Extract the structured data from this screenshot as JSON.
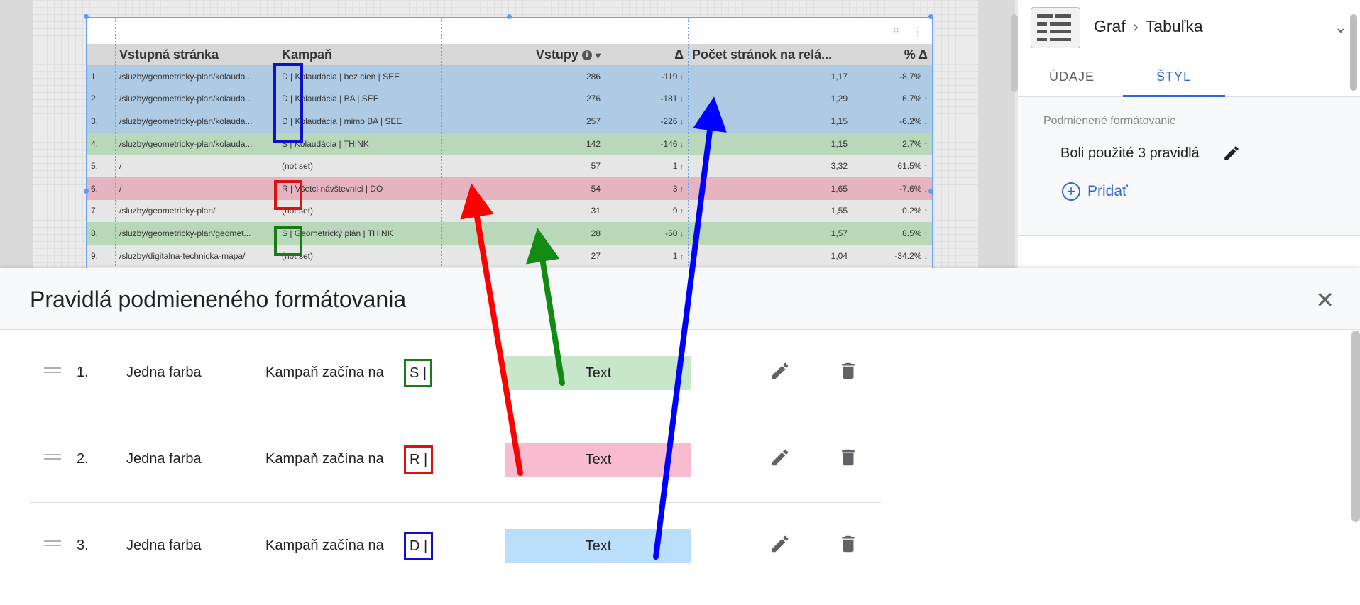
{
  "report": {
    "columns": [
      "",
      "Vstupná stránka",
      "Kampaň",
      "Vstupy",
      "Δ",
      "Počet stránok na relá...",
      "% Δ"
    ],
    "sort_indicator": "▾",
    "info_icon": "i",
    "rows": [
      {
        "idx": "1.",
        "page": "/sluzby/geometricky-plan/kolauda...",
        "campaign": "D | Kolaudácia | bez cien | SEE",
        "entries": "286",
        "delta": "-119",
        "delta_dir": "down",
        "pages": "1,17",
        "pct": "-8.7%",
        "pct_dir": "down",
        "color": "#aecbe3"
      },
      {
        "idx": "2.",
        "page": "/sluzby/geometricky-plan/kolauda...",
        "campaign": "D | Kolaudácia | BA | SEE",
        "entries": "276",
        "delta": "-181",
        "delta_dir": "down",
        "pages": "1,29",
        "pct": "6.7%",
        "pct_dir": "up",
        "color": "#aecbe3"
      },
      {
        "idx": "3.",
        "page": "/sluzby/geometricky-plan/kolauda...",
        "campaign": "D | Kolaudácia | mimo BA | SEE",
        "entries": "257",
        "delta": "-226",
        "delta_dir": "down",
        "pages": "1,15",
        "pct": "-6.2%",
        "pct_dir": "down",
        "color": "#aecbe3"
      },
      {
        "idx": "4.",
        "page": "/sluzby/geometricky-plan/kolauda...",
        "campaign": "S | Kolaudácia | THINK",
        "entries": "142",
        "delta": "-146",
        "delta_dir": "down",
        "pages": "1,15",
        "pct": "2.7%",
        "pct_dir": "up",
        "color": "#b9d8b9"
      },
      {
        "idx": "5.",
        "page": "/",
        "campaign": "(not set)",
        "entries": "57",
        "delta": "1",
        "delta_dir": "up",
        "pages": "3,32",
        "pct": "61.5%",
        "pct_dir": "up",
        "color": "#e6e6e6"
      },
      {
        "idx": "6.",
        "page": "/",
        "campaign": "R | Všetci návštevníci | DO",
        "entries": "54",
        "delta": "3",
        "delta_dir": "up",
        "pages": "1,65",
        "pct": "-7.6%",
        "pct_dir": "down",
        "color": "#e6b4c1"
      },
      {
        "idx": "7.",
        "page": "/sluzby/geometricky-plan/",
        "campaign": "(not set)",
        "entries": "31",
        "delta": "9",
        "delta_dir": "up",
        "pages": "1,55",
        "pct": "0.2%",
        "pct_dir": "up",
        "color": "#e6e6e6"
      },
      {
        "idx": "8.",
        "page": "/sluzby/geometricky-plan/geomet...",
        "campaign": "S | Geometrický plán | THINK",
        "entries": "28",
        "delta": "-50",
        "delta_dir": "down",
        "pages": "1,57",
        "pct": "8.5%",
        "pct_dir": "up",
        "color": "#b9d8b9"
      },
      {
        "idx": "9.",
        "page": "/sluzby/digitalna-technicka-mapa/",
        "campaign": "(not set)",
        "entries": "27",
        "delta": "1",
        "delta_dir": "up",
        "pages": "1,04",
        "pct": "-34.2%",
        "pct_dir": "down",
        "color": "#e6e6e6"
      }
    ]
  },
  "side": {
    "breadcrumb_1": "Graf",
    "breadcrumb_sep": "›",
    "breadcrumb_2": "Tabuľka",
    "tab_data": "ÚDAJE",
    "tab_style": "ŠTÝL",
    "cf_label": "Podmienené formátovanie",
    "cf_applied": "Boli použité 3 pravidlá",
    "cf_add": "Pridať"
  },
  "dialog": {
    "title": "Pravidlá podmieneného formátovania",
    "rules": [
      {
        "num": "1.",
        "kind": "Jedna farba",
        "cond": "Kampaň začína na",
        "value": "S |",
        "swatch_text": "Text",
        "swatch_color": "#c8e6c9",
        "marker_color": "#1a7a1a"
      },
      {
        "num": "2.",
        "kind": "Jedna farba",
        "cond": "Kampaň začína na",
        "value": "R |",
        "swatch_text": "Text",
        "swatch_color": "#f8bbd0",
        "marker_color": "#e01010"
      },
      {
        "num": "3.",
        "kind": "Jedna farba",
        "cond": "Kampaň začína na",
        "value": "D |",
        "swatch_text": "Text",
        "swatch_color": "#bbdefb",
        "marker_color": "#1010c8"
      }
    ]
  },
  "colors": {
    "accent": "#3367d6",
    "arrow_red": "#ff0000",
    "arrow_green": "#138a13",
    "arrow_blue": "#0000ff"
  }
}
